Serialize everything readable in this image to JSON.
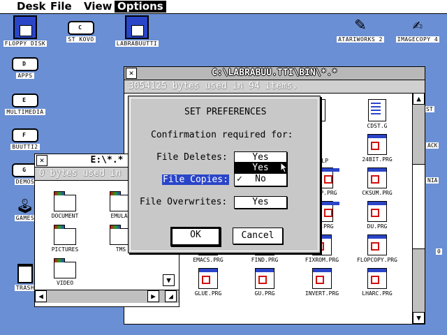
{
  "menubar": {
    "items": [
      "Desk",
      "File",
      "View",
      "Options"
    ],
    "active_index": 3
  },
  "desktop_icons": {
    "floppy": "FLOPPY DISK",
    "st_kovo": "ST KOVO",
    "labrabuutti": "LABRABUUTTI",
    "atariworks": "ATARIWORKS 2",
    "imagecopy": "IMAGECOPY 4",
    "apps": "APPS",
    "multimedia": "MULTIMEDIA",
    "buutti2": "BUUTTI2",
    "demos": "DEMOS",
    "games": "GAMES",
    "trash": "TRASH",
    "drive_letters": {
      "st_kovo": "C",
      "apps": "D",
      "multimedia": "E",
      "buutti2": "F",
      "demos": "G"
    },
    "edge_partial": {
      "a": "ST",
      "b": "ACK",
      "c": "NIA",
      "d": "0"
    }
  },
  "bin_window": {
    "title": "C:\\LABRABUU.TTI\\BIN\\*.*",
    "info": "3054125 bytes used in 94 items.",
    "files": [
      {
        "name": "CDST.G",
        "type": "doc"
      },
      {
        "name": "24BIT.PRG",
        "type": "prg"
      },
      {
        "name": "CKSUM.PRG",
        "type": "prg"
      },
      {
        "name": "DU.PRG",
        "type": "prg"
      },
      {
        "name": "FLOPCOPY.PRG",
        "type": "prg"
      },
      {
        "name": "EMACS.PRG",
        "type": "prg"
      },
      {
        "name": "FIND.PRG",
        "type": "prg"
      },
      {
        "name": "FIXROM.PRG",
        "type": "prg"
      },
      {
        "name": "GLUE.PRG",
        "type": "prg"
      },
      {
        "name": "GU.PRG",
        "type": "prg"
      },
      {
        "name": "INVERT.PRG",
        "type": "prg"
      },
      {
        "name": "LHARC.PRG",
        "type": "prg"
      }
    ],
    "partial_labels": [
      "P.G",
      "M.HLP",
      "AP.PRG",
      ".PRG",
      "PRG"
    ]
  },
  "e_window": {
    "title": "E:\\*.*",
    "info": "0 bytes used in",
    "items": [
      "DOCUMENT",
      "EMULAT",
      "PICTURES",
      "TMS",
      "VIDEO"
    ]
  },
  "dialog": {
    "title": "SET PREFERENCES",
    "subtitle": "Confirmation required for:",
    "rows": [
      {
        "label": "File Deletes:",
        "value": "Yes"
      },
      {
        "label": "File Copies:",
        "value": "No"
      },
      {
        "label": "File Overwrites:",
        "value": "Yes"
      }
    ],
    "popup_options": [
      "Yes",
      "No"
    ],
    "popup_highlighted": "Yes",
    "popup_checked": "No",
    "check_mark": "✓",
    "ok_label": "OK",
    "cancel_label": "Cancel"
  },
  "colors": {
    "desktop": "#6a8fd4",
    "accent": "#2a45c8",
    "highlight": "#2a45c8"
  }
}
